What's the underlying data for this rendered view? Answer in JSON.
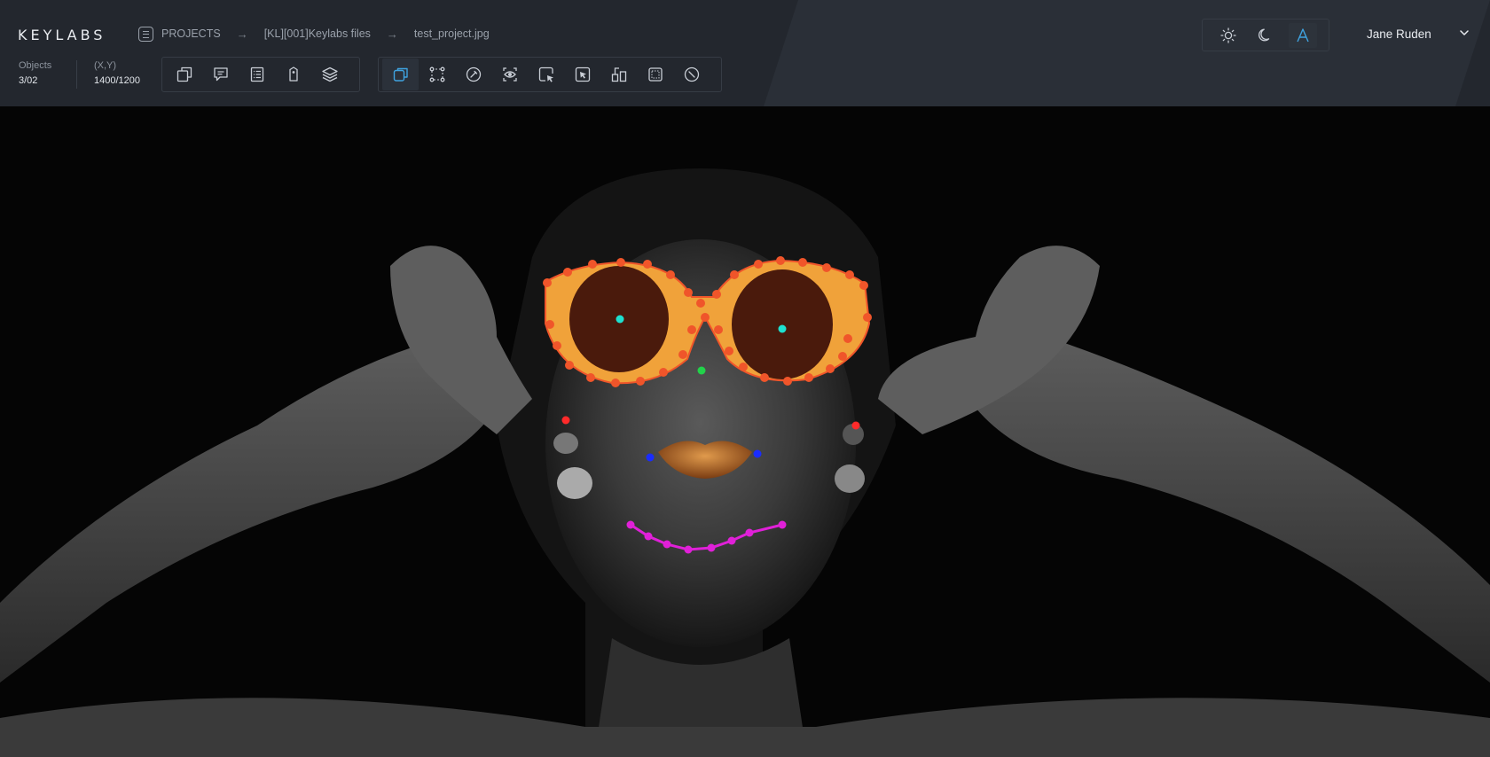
{
  "app": {
    "logo": "KEYLABS"
  },
  "breadcrumb": {
    "root": "PROJECTS",
    "project": "[KL][001]Keylabs files",
    "file": "test_project.jpg",
    "separator": "→"
  },
  "theme_modes": [
    {
      "icon": "sun-icon",
      "active": false
    },
    {
      "icon": "moon-icon",
      "active": false
    },
    {
      "icon": "auto-a-icon",
      "active": true
    }
  ],
  "user": {
    "name": "Jane Ruden",
    "menu_icon": "chevron-down-icon"
  },
  "stats": {
    "objects_label": "Objects",
    "objects_value": "3/02",
    "coords_label": "(X,Y)",
    "coords_value": "1400/1200"
  },
  "toolbar_left": [
    {
      "icon": "shapes-icon"
    },
    {
      "icon": "comment-icon"
    },
    {
      "icon": "list-icon"
    },
    {
      "icon": "tag-icon"
    },
    {
      "icon": "layers-icon"
    }
  ],
  "toolbar_right": [
    {
      "icon": "bounding-box-icon",
      "active": true
    },
    {
      "icon": "polygon-points-icon",
      "active": false
    },
    {
      "icon": "magic-wand-icon",
      "active": false
    },
    {
      "icon": "eye-target-icon",
      "active": false
    },
    {
      "icon": "select-cursor-icon",
      "active": false
    },
    {
      "icon": "crop-cursor-icon",
      "active": false
    },
    {
      "icon": "split-shapes-icon",
      "active": false
    },
    {
      "icon": "dotted-box-icon",
      "active": false
    },
    {
      "icon": "no-entry-icon",
      "active": false
    }
  ],
  "colors": {
    "accent": "#3fa3e0",
    "glasses_fill": "#f0a23a",
    "glasses_points": "#f0552a",
    "lens": "#4a1a0c",
    "eye_points": "#1ee0d0",
    "nose_point": "#22d24a",
    "ear_points": "#ff2a2a",
    "mouth_corners": "#1a2cff",
    "chin_curve": "#e020d8",
    "lips": "#b86a25"
  }
}
